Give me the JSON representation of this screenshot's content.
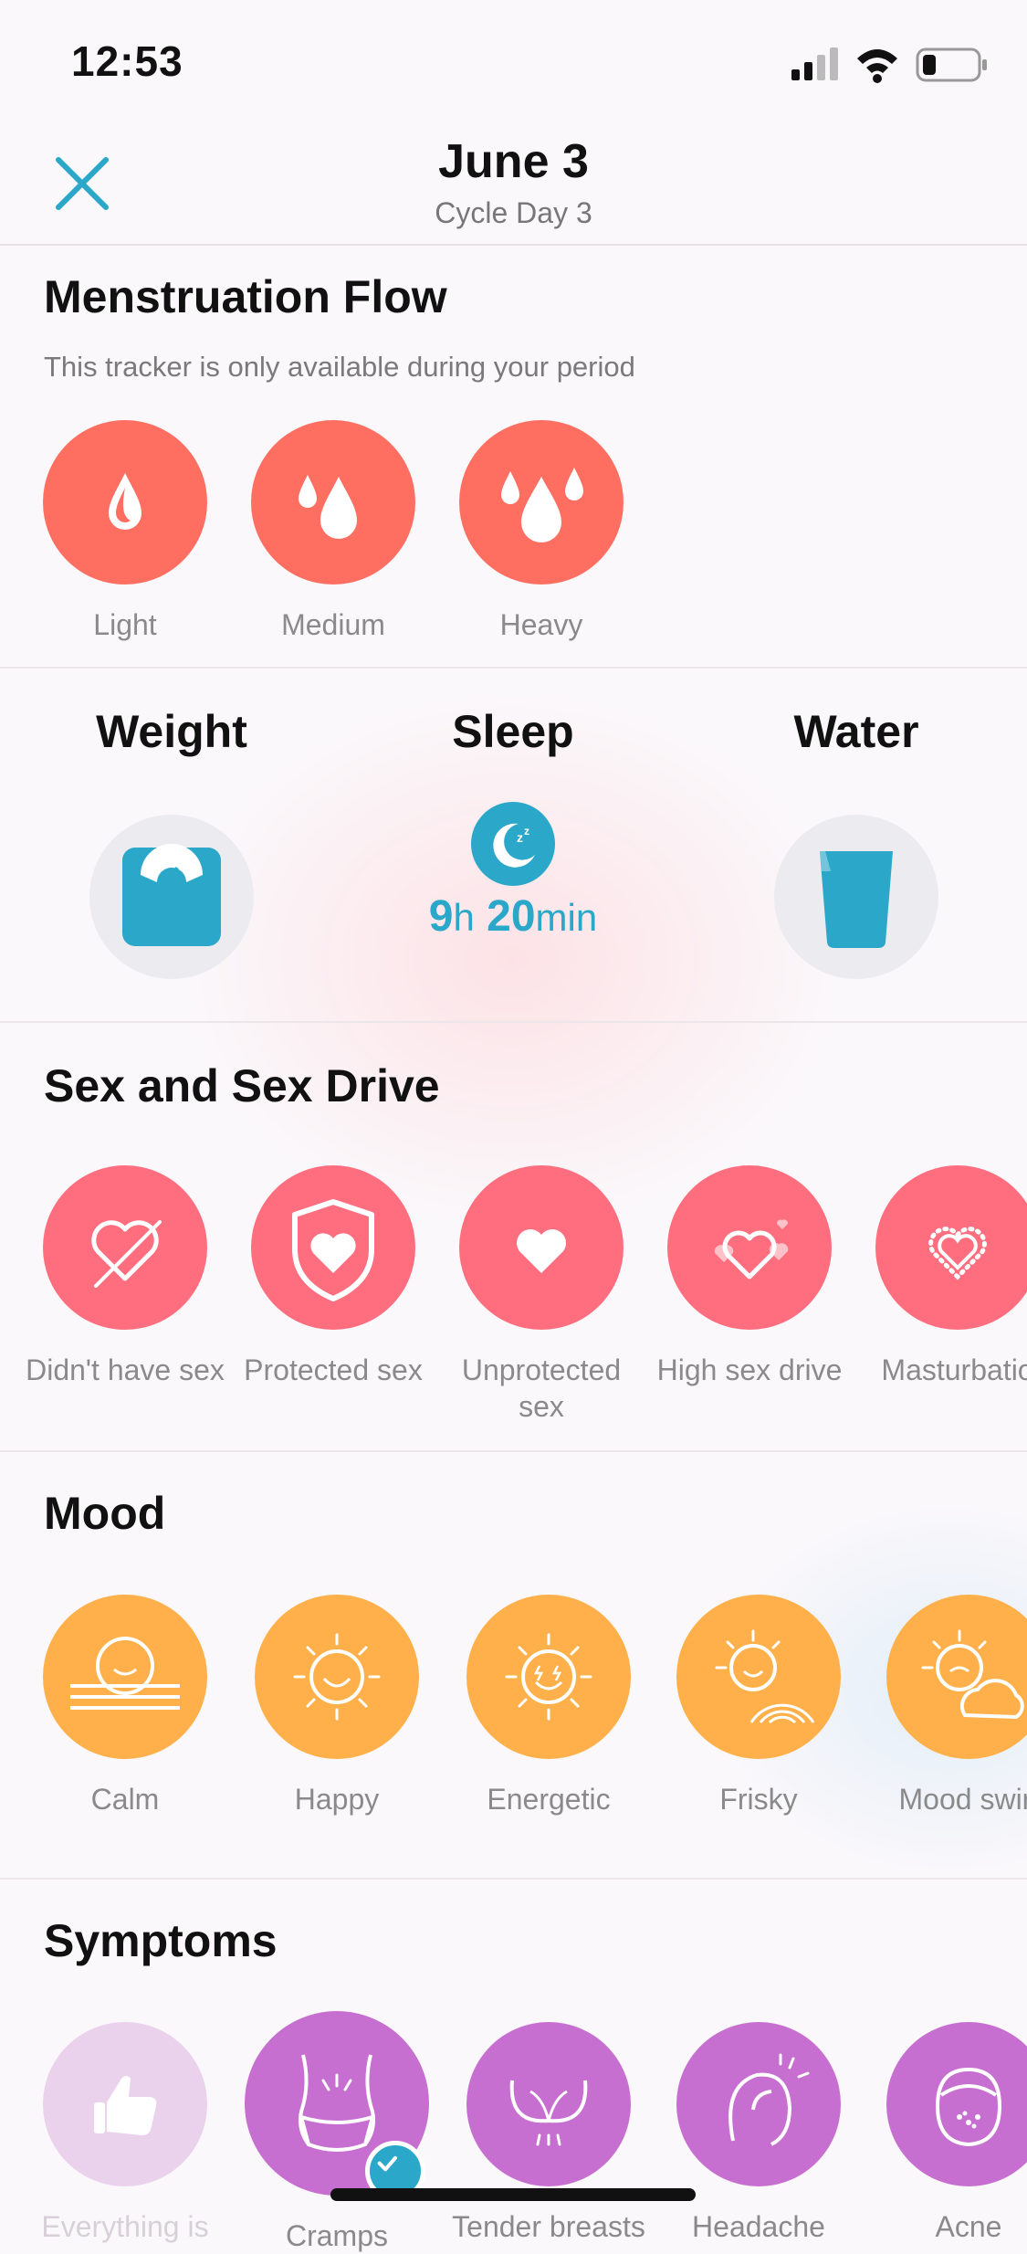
{
  "status_bar": {
    "time": "12:53"
  },
  "header": {
    "title": "June 3",
    "subtitle": "Cycle Day 3"
  },
  "flow": {
    "title": "Menstruation Flow",
    "note": "This tracker is only available during your period",
    "options": [
      {
        "label": "Light",
        "icon": "single-drop-icon"
      },
      {
        "label": "Medium",
        "icon": "two-drops-icon"
      },
      {
        "label": "Heavy",
        "icon": "three-drops-icon"
      }
    ]
  },
  "metrics": {
    "weight": {
      "title": "Weight",
      "icon": "scale-icon"
    },
    "sleep": {
      "title": "Sleep",
      "icon": "moon-sleep-icon",
      "hours": "9",
      "hours_unit": "h",
      "minutes": "20",
      "minutes_unit": "min"
    },
    "water": {
      "title": "Water",
      "icon": "water-glass-icon"
    }
  },
  "sex": {
    "title": "Sex and Sex Drive",
    "options": [
      {
        "label": "Didn't have sex",
        "icon": "crossed-heart-icon"
      },
      {
        "label": "Protected sex",
        "icon": "shield-heart-icon"
      },
      {
        "label": "Unprotected sex",
        "icon": "heart-icon"
      },
      {
        "label": "High sex drive",
        "icon": "hearts-icon"
      },
      {
        "label": "Masturbatio",
        "icon": "dotted-heart-icon"
      }
    ]
  },
  "mood": {
    "title": "Mood",
    "options": [
      {
        "label": "Calm",
        "icon": "calm-sun-icon"
      },
      {
        "label": "Happy",
        "icon": "happy-sun-icon"
      },
      {
        "label": "Energetic",
        "icon": "energetic-sun-icon"
      },
      {
        "label": "Frisky",
        "icon": "rainbow-sun-icon"
      },
      {
        "label": "Mood swin",
        "icon": "cloud-sun-icon"
      }
    ]
  },
  "symptoms": {
    "title": "Symptoms",
    "options": [
      {
        "label": "Everything is",
        "icon": "thumbs-up-icon",
        "selected": false
      },
      {
        "label": "Cramps",
        "icon": "cramps-body-icon",
        "selected": true
      },
      {
        "label": "Tender breasts",
        "icon": "breasts-icon",
        "selected": false
      },
      {
        "label": "Headache",
        "icon": "headache-icon",
        "selected": false
      },
      {
        "label": "Acne",
        "icon": "acne-face-icon",
        "selected": false
      }
    ]
  },
  "colors": {
    "accent": "#2aa7c9",
    "flow": "#ff6f61",
    "sex": "#ff6e7e",
    "mood": "#ffb04a",
    "symptoms": "#c76fd0"
  }
}
